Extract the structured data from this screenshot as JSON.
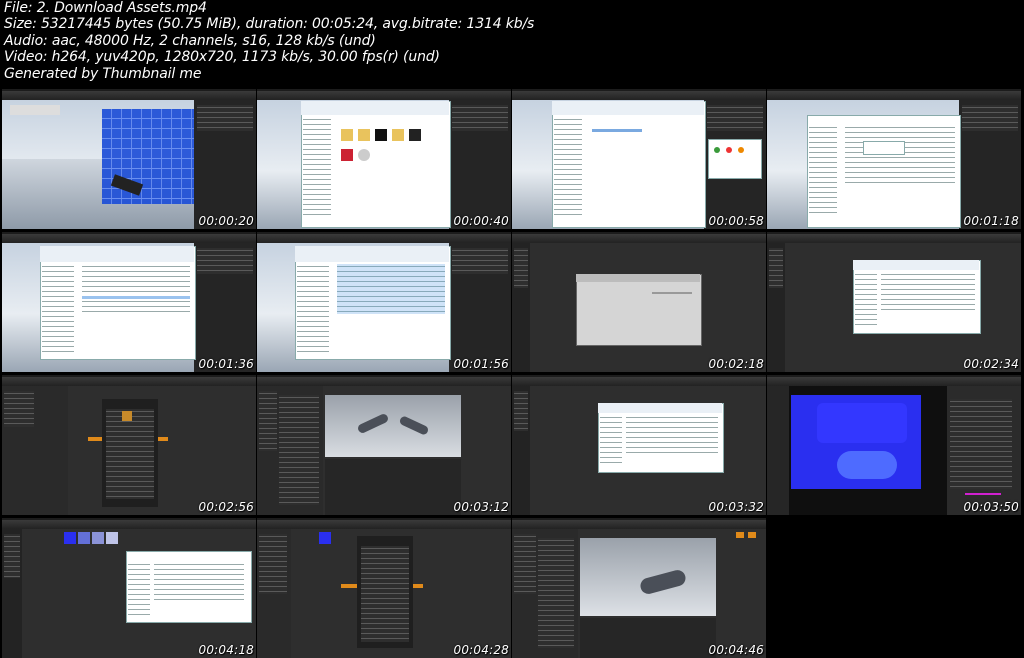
{
  "header": {
    "file": "File: 2. Download Assets.mp4",
    "size": "Size: 53217445 bytes (50.75 MiB), duration: 00:05:24, avg.bitrate: 1314 kb/s",
    "audio": "Audio: aac, 48000 Hz, 2 channels, s16, 128 kb/s (und)",
    "video": "Video: h264, yuv420p, 1280x720, 1173 kb/s, 30.00 fps(r) (und)",
    "generator": "Generated by Thumbnail me"
  },
  "thumbnails": [
    {
      "time": "00:00:20",
      "scene": "ue-viewport-blue-wall"
    },
    {
      "time": "00:00:40",
      "scene": "explorer-folders"
    },
    {
      "time": "00:00:58",
      "scene": "explorer-empty-with-dialog"
    },
    {
      "time": "00:01:18",
      "scene": "explorer-file-list-popup"
    },
    {
      "time": "00:01:36",
      "scene": "explorer-file-list"
    },
    {
      "time": "00:01:56",
      "scene": "explorer-file-list-selected"
    },
    {
      "time": "00:02:18",
      "scene": "ue-dark-import-dialog"
    },
    {
      "time": "00:02:34",
      "scene": "ue-dark-file-dialog"
    },
    {
      "time": "00:02:56",
      "scene": "ue-material-editor"
    },
    {
      "time": "00:03:12",
      "scene": "ue-mesh-editor-gloves"
    },
    {
      "time": "00:03:32",
      "scene": "ue-dark-file-dialog-2"
    },
    {
      "time": "00:03:50",
      "scene": "ue-normal-map"
    },
    {
      "time": "00:04:18",
      "scene": "ue-content-file-dialog"
    },
    {
      "time": "00:04:28",
      "scene": "ue-material-editor-2"
    },
    {
      "time": "00:04:46",
      "scene": "ue-mesh-editor-glove"
    }
  ],
  "colors": {
    "background": "#000000",
    "text": "#ffffff",
    "ue_dark": "#2e2e2e",
    "normal_blue": "#2a2ff0",
    "accent_orange": "#e08a1a",
    "magenta": "#d020d0"
  }
}
